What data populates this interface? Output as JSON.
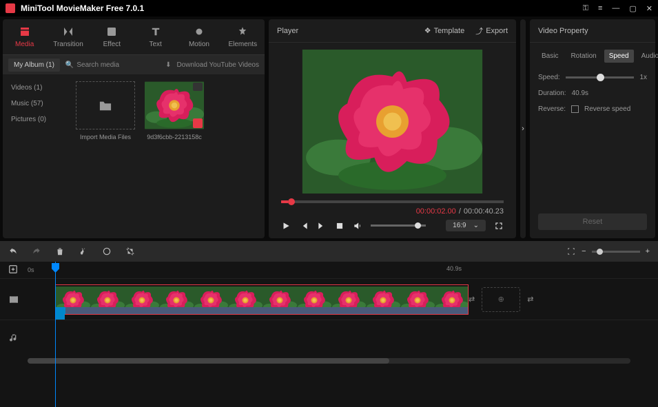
{
  "app": {
    "title": "MiniTool MovieMaker Free 7.0.1"
  },
  "mediaTabs": {
    "media": "Media",
    "transition": "Transition",
    "effect": "Effect",
    "text": "Text",
    "motion": "Motion",
    "elements": "Elements"
  },
  "mediaBar": {
    "album": "My Album (1)",
    "searchPlaceholder": "Search media",
    "download": "Download YouTube Videos"
  },
  "sideNav": {
    "videos": "Videos (1)",
    "music": "Music (57)",
    "pictures": "Pictures (0)"
  },
  "grid": {
    "import": "Import Media Files",
    "clipName": "9d3f6cbb-2213158c"
  },
  "player": {
    "title": "Player",
    "template": "Template",
    "export": "Export",
    "cur": "00:00:02.00",
    "sep": " / ",
    "dur": "00:00:40.23",
    "ratio": "16:9"
  },
  "property": {
    "title": "Video Property",
    "tabs": {
      "basic": "Basic",
      "rotation": "Rotation",
      "speed": "Speed",
      "audio": "Audio"
    },
    "speedLabel": "Speed:",
    "speedValue": "1x",
    "durationLabel": "Duration:",
    "durationValue": "40.9s",
    "reverseLabel": "Reverse:",
    "reverseCheck": "Reverse speed",
    "reset": "Reset"
  },
  "timeline": {
    "start": "0s",
    "end": "40.9s"
  }
}
